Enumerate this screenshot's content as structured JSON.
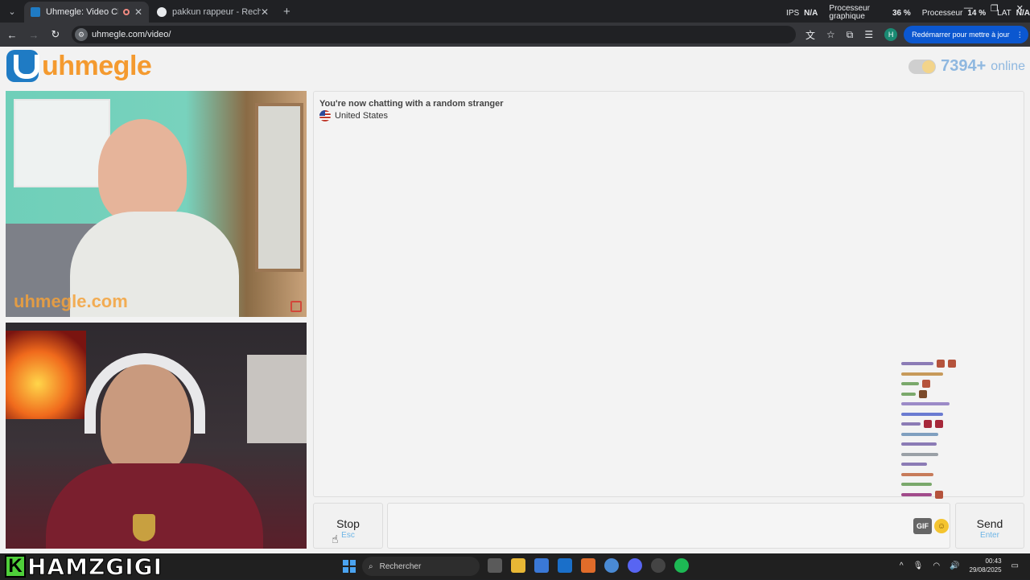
{
  "browser": {
    "tabs": [
      {
        "title": "Uhmegle: Video Chat | Om",
        "active": true,
        "favicon_color": "#1f7bc4"
      },
      {
        "title": "pakkun rappeur - Recherche G",
        "active": false,
        "favicon_color": "#e8eaed"
      }
    ],
    "perf": {
      "ips_label": "IPS",
      "ips_value": "N/A",
      "gpu_label_1": "Processeur",
      "gpu_label_2": "graphique",
      "gpu_value": "36 %",
      "cpu_label": "Processeur",
      "cpu_value": "14 %",
      "lat_label": "LAT",
      "lat_value": "N/A"
    },
    "address": "uhmegle.com/video/",
    "restart_label": "Redémarrer pour mettre à jour"
  },
  "site": {
    "logo_text": "uhmegle",
    "online_count": "7394+",
    "online_label": "online"
  },
  "video": {
    "watermark": "uhmegle.com"
  },
  "chat": {
    "status": "You're now chatting with a random stranger",
    "country": "United States"
  },
  "controls": {
    "stop_label": "Stop",
    "stop_key": "Esc",
    "gif_label": "GIF",
    "send_label": "Send",
    "send_key": "Enter"
  },
  "stream": {
    "badge_letter": "K",
    "name": "HAMZGIGI"
  },
  "taskbar": {
    "search_placeholder": "Rechercher",
    "time": "00:43",
    "date": "29/08/2025"
  },
  "colors": {
    "accent_orange": "#f49a2f",
    "accent_blue": "#1f7bc4",
    "online_blue": "#8fb8e0"
  }
}
